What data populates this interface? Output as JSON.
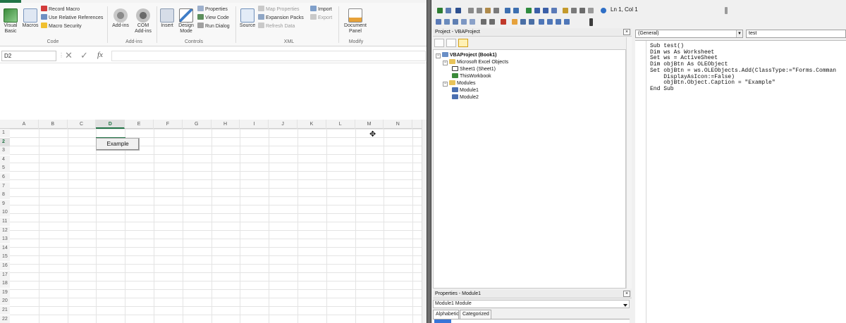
{
  "excel": {
    "ribbon": {
      "visual_basic": "Visual\nBasic",
      "macros": "Macros",
      "record_macro": "Record Macro",
      "use_relative_refs": "Use Relative References",
      "macro_security": "Macro Security",
      "group_code": "Code",
      "add_ins": "Add-ins",
      "com_add_ins": "COM\nAdd-ins",
      "group_add_ins": "Add-ins",
      "insert": "Insert",
      "design_mode": "Design\nMode",
      "properties": "Properties",
      "view_code": "View Code",
      "run_dialog": "Run Dialog",
      "group_controls": "Controls",
      "source": "Source",
      "map_properties": "Map Properties",
      "expansion_packs": "Expansion Packs",
      "refresh_data": "Refresh Data",
      "import": "Import",
      "export": "Export",
      "group_xml": "XML",
      "document_panel": "Document\nPanel",
      "group_modify": "Modify"
    },
    "formula_bar": {
      "name_box": "D2",
      "cancel_glyph": "✕",
      "enter_glyph": "✓",
      "fx": "fx",
      "formula": ""
    },
    "columns": [
      "A",
      "B",
      "C",
      "D",
      "E",
      "F",
      "G",
      "H",
      "I",
      "J",
      "K",
      "L",
      "M",
      "N"
    ],
    "rows": [
      "1",
      "2",
      "3",
      "4",
      "5",
      "6",
      "7",
      "8",
      "9",
      "10",
      "11",
      "12",
      "13",
      "14",
      "15",
      "16",
      "17",
      "18",
      "19",
      "20",
      "21",
      "22"
    ],
    "selected_cell": "D2",
    "embedded_button_caption": "Example"
  },
  "vbe": {
    "toolbar_position": "Ln 1, Col 1",
    "project_pane_title": "Project - VBAProject",
    "tree": {
      "root": "VBAProject (Book1)",
      "folder_objects": "Microsoft Excel Objects",
      "sheet1": "Sheet1 (Sheet1)",
      "thisworkbook": "ThisWorkbook",
      "folder_modules": "Modules",
      "module1": "Module1",
      "module2": "Module2"
    },
    "properties_pane_title": "Properties - Module1",
    "properties_object": "Module1 Module",
    "properties_tabs": [
      "Alphabetic",
      "Categorized"
    ],
    "code_object_dropdown": "(General)",
    "code_proc_dropdown": "test",
    "code_lines": [
      "Sub test()",
      "Dim ws As Worksheet",
      "Set ws = ActiveSheet",
      "Dim objBtn As OLEObject",
      "Set objBtn = ws.OLEObjects.Add(ClassType:=\"Forms.Comman",
      "    DisplayAsIcon:=False)",
      "    objBtn.Object.Caption = \"Example\"",
      "End Sub"
    ]
  }
}
